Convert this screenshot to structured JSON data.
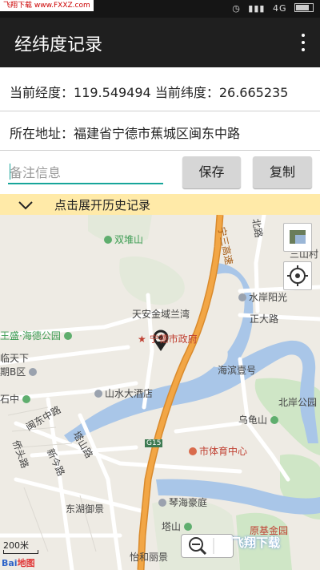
{
  "status_bar": {
    "left_text": "飞翔下载 www.FXXZ.com",
    "network": "4G",
    "icons": [
      "alarm-icon",
      "signal-icon",
      "wifi-icon",
      "battery-icon"
    ]
  },
  "app_bar": {
    "title": "经纬度记录",
    "menu_icon": "more-vertical-icon"
  },
  "coords": {
    "lng_label": "当前经度：",
    "lng_value": "119.549494",
    "lat_label": "当前纬度：",
    "lat_value": "26.665235"
  },
  "address": {
    "label": "所在地址：",
    "value": "福建省宁德市蕉城区闽东中路"
  },
  "note": {
    "placeholder": "备注信息",
    "value": ""
  },
  "buttons": {
    "save": "保存",
    "copy": "复制"
  },
  "history": {
    "label": "点击展开历史记录",
    "icon": "chevron-down-icon"
  },
  "map": {
    "labels": {
      "shuangdui": "双堆山",
      "tianan": "天安金域兰湾",
      "shizhengfu": "宁德市政府",
      "shuian": "水岸阳光",
      "zhengda": "正大路",
      "haide": "王盛·海德公园",
      "linda1": "临天下",
      "linda2": "期B区",
      "shanshui": "山水大酒店",
      "haibin": "海滨壹号",
      "beian": "北岸公园",
      "wuguishan": "乌龟山",
      "tiyu": "市体育中心",
      "mindong": "闽东中路",
      "qiaotou": "侨头路",
      "xinjin": "新今路",
      "tashan": "塔山路",
      "donghu": "东湖御景",
      "qinhai": "琴海豪庭",
      "tashan2": "塔山",
      "yihe": "怡和丽景",
      "g15": "G15",
      "ningsan": "宁三高速",
      "beilu": "北路",
      "sancun": "三山村",
      "shizhu": "石中",
      "xiyuan": "原基金园"
    },
    "scale": "200米",
    "logo_prefix": "Bai",
    "logo_suffix": "地图",
    "watermark": "飞翔下载"
  }
}
